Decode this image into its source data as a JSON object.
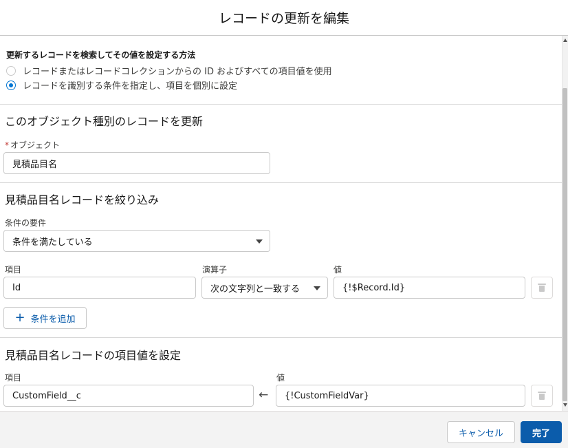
{
  "modal": {
    "title": "レコードの更新を編集"
  },
  "method": {
    "label": "更新するレコードを検索してその値を設定する方法",
    "options": [
      {
        "label": "レコードまたはレコードコレクションからの ID およびすべての項目値を使用",
        "selected": false
      },
      {
        "label": "レコードを識別する条件を指定し、項目を個別に設定",
        "selected": true
      }
    ]
  },
  "object_section": {
    "title": "このオブジェクト種別のレコードを更新",
    "required_mark": "*",
    "object_label": "オブジェクト",
    "object_value": "見積品目名"
  },
  "filter_section": {
    "title": "見積品目名レコードを絞り込み",
    "condition_label": "条件の要件",
    "condition_value": "条件を満たしている",
    "field_label": "項目",
    "operator_label": "演算子",
    "value_label": "値",
    "row": {
      "field": "Id",
      "operator": "次の文字列と一致する",
      "value": "{!$Record.Id}"
    },
    "add_condition": "条件を追加"
  },
  "set_section": {
    "title": "見積品目名レコードの項目値を設定",
    "field_label": "項目",
    "value_label": "値",
    "row": {
      "field": "CustomField__c",
      "value": "{!CustomFieldVar}"
    }
  },
  "footer": {
    "cancel": "キャンセル",
    "done": "完了"
  },
  "colors": {
    "brand": "#0b5cab",
    "radio": "#0176d3",
    "required": "#c23934"
  }
}
